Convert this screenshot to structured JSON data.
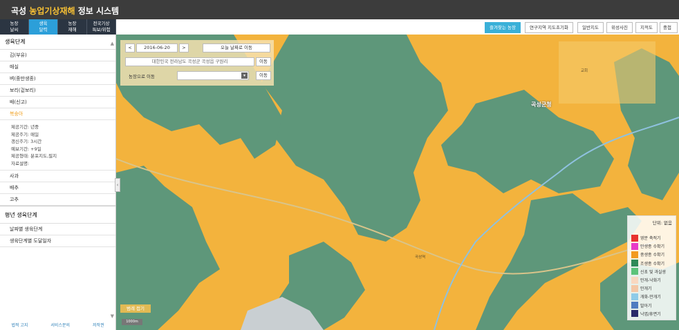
{
  "header": {
    "title_pre": "곡성 ",
    "title_hl": "농업기상재해",
    "title_post": " 정보 시스템"
  },
  "tabs": [
    {
      "label": "농장\n날씨"
    },
    {
      "label": "생육\n달력"
    },
    {
      "label": "농장\n재해"
    },
    {
      "label": "전국기상\n특보/위험"
    }
  ],
  "sidebar": {
    "heading": "생육단계",
    "items": [
      "김(부유)",
      "매실",
      "벼(중만생종)",
      "보리(겉보리)",
      "배(신고)",
      "복숭아"
    ],
    "detail_lines": [
      "제공기간: 년중",
      "제공주기: 매일",
      "갱신주기: 3시간",
      "예보기간: +9일",
      "제공형태: 분포지도,필지",
      "자료설명:"
    ],
    "items2": [
      "사과",
      "배추",
      "고추"
    ],
    "section2": "평년 생육단계",
    "items3": [
      "날짜별 생육단계",
      "생육단계별 도달일자"
    ]
  },
  "footer": [
    "법적 고지",
    "서비스문의",
    "저작권"
  ],
  "map_toolbar": [
    "즐겨찾는 농장",
    "연구지역 지도초기화",
    "일반지도",
    "위성사진",
    "지적도",
    "중첩"
  ],
  "controls": {
    "date": "2016-06-20",
    "prev": "<",
    "next": ">",
    "today_btn": "오늘 날짜로 이동",
    "address": "대한민국 전라남도 곡성군 곡성읍 구원리",
    "move_btn": "이동",
    "farm_label": "농장으로 이동",
    "farm_select": "",
    "farm_move": "이동"
  },
  "legend": {
    "title": "단위: 없음",
    "items": [
      {
        "label": "영분 축적기",
        "color": "#e8322e"
      },
      {
        "label": "만생종 수확기",
        "color": "#e83cc8"
      },
      {
        "label": "중생종 수확기",
        "color": "#f39a1e"
      },
      {
        "label": "조생종 수확기",
        "color": "#2e8a58"
      },
      {
        "label": "신초 및 과실생",
        "color": "#5cc37a"
      },
      {
        "label": "만개-낙화기",
        "color": "#f9d8c0"
      },
      {
        "label": "만개기",
        "color": "#f4c7a6"
      },
      {
        "label": "개화-만개기",
        "color": "#8ecbe8"
      },
      {
        "label": "발아기",
        "color": "#4f7cc0"
      },
      {
        "label": "낙엽/휴면기",
        "color": "#2a2a6a"
      }
    ]
  },
  "map": {
    "collapse_btn": "범례 접기",
    "scale": "1000m",
    "labels": [
      "곡성군청",
      "교회",
      "곡성역"
    ]
  }
}
